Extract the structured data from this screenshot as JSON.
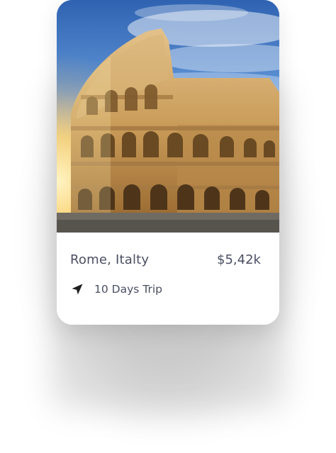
{
  "card": {
    "title": "Rome, Italty",
    "price": "$5,42k",
    "trip_label": "10 Days Trip",
    "trip_icon": "navigation-arrow-icon"
  },
  "colors": {
    "text": "#4b4f62",
    "card_bg": "#ffffff"
  }
}
